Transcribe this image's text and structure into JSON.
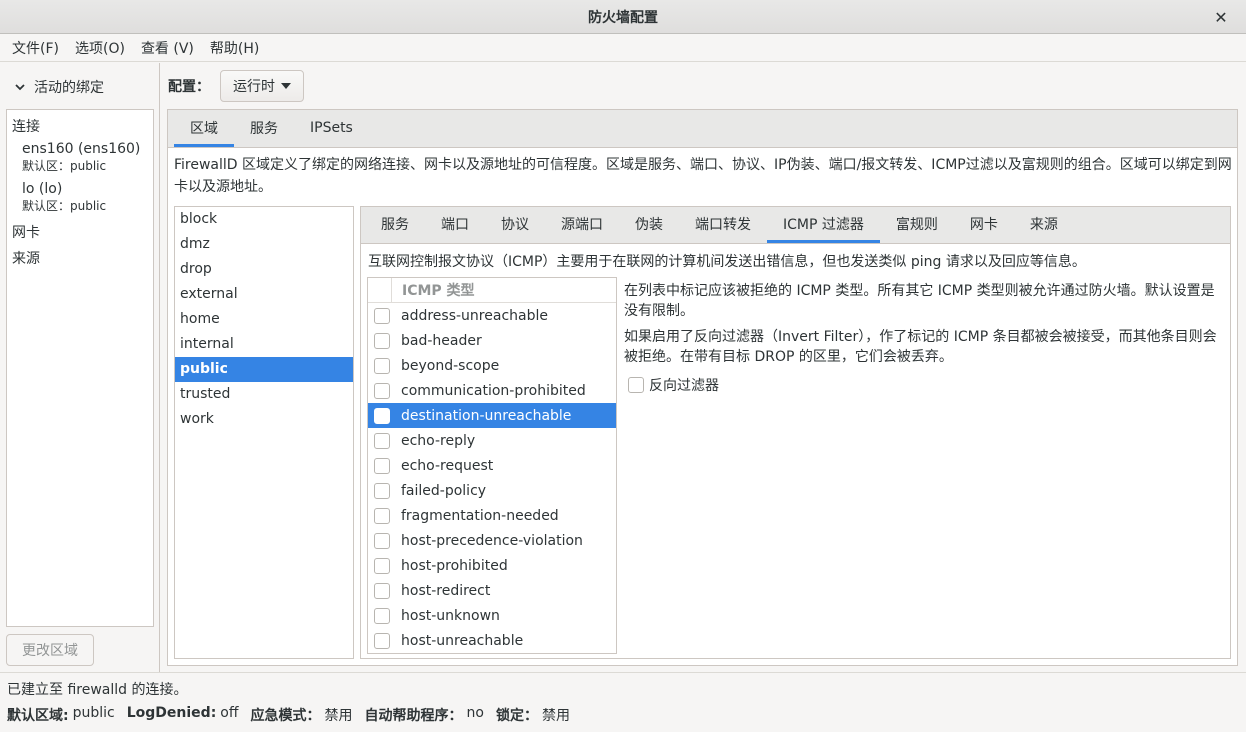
{
  "window": {
    "title": "防火墙配置"
  },
  "menu": [
    {
      "label": "文件(F)"
    },
    {
      "label": "选项(O)"
    },
    {
      "label": "查看 (V)"
    },
    {
      "label": "帮助(H)"
    }
  ],
  "bindings": {
    "header": "活动的绑定",
    "connections_heading": "连接",
    "connections": [
      {
        "name": "ens160 (ens160)",
        "zone": "默认区：public"
      },
      {
        "name": "lo (lo)",
        "zone": "默认区：public"
      }
    ],
    "interfaces_heading": "网卡",
    "sources_heading": "来源",
    "change_zone_button": "更改区域"
  },
  "config": {
    "label": "配置：",
    "value": "运行时"
  },
  "main_tabs": [
    {
      "label": "区域",
      "active": true
    },
    {
      "label": "服务",
      "active": false
    },
    {
      "label": "IPSets",
      "active": false
    }
  ],
  "zone_description": "FirewallD 区域定义了绑定的网络连接、网卡以及源地址的可信程度。区域是服务、端口、协议、IP伪装、端口/报文转发、ICMP过滤以及富规则的组合。区域可以绑定到网卡以及源地址。",
  "zones": [
    {
      "name": "block",
      "selected": false
    },
    {
      "name": "dmz",
      "selected": false
    },
    {
      "name": "drop",
      "selected": false
    },
    {
      "name": "external",
      "selected": false
    },
    {
      "name": "home",
      "selected": false
    },
    {
      "name": "internal",
      "selected": false
    },
    {
      "name": "public",
      "selected": true
    },
    {
      "name": "trusted",
      "selected": false
    },
    {
      "name": "work",
      "selected": false
    }
  ],
  "zone_tabs": [
    {
      "label": "服务",
      "active": false
    },
    {
      "label": "端口",
      "active": false
    },
    {
      "label": "协议",
      "active": false
    },
    {
      "label": "源端口",
      "active": false
    },
    {
      "label": "伪装",
      "active": false
    },
    {
      "label": "端口转发",
      "active": false
    },
    {
      "label": "ICMP 过滤器",
      "active": true
    },
    {
      "label": "富规则",
      "active": false
    },
    {
      "label": "网卡",
      "active": false
    },
    {
      "label": "来源",
      "active": false
    }
  ],
  "icmp": {
    "description": "互联网控制报文协议（ICMP）主要用于在联网的计算机间发送出错信息，但也发送类似 ping 请求以及回应等信息。",
    "column_header": "ICMP 类型",
    "types": [
      {
        "name": "address-unreachable",
        "checked": false,
        "selected": false
      },
      {
        "name": "bad-header",
        "checked": false,
        "selected": false
      },
      {
        "name": "beyond-scope",
        "checked": false,
        "selected": false
      },
      {
        "name": "communication-prohibited",
        "checked": false,
        "selected": false
      },
      {
        "name": "destination-unreachable",
        "checked": false,
        "selected": true
      },
      {
        "name": "echo-reply",
        "checked": false,
        "selected": false
      },
      {
        "name": "echo-request",
        "checked": false,
        "selected": false
      },
      {
        "name": "failed-policy",
        "checked": false,
        "selected": false
      },
      {
        "name": "fragmentation-needed",
        "checked": false,
        "selected": false
      },
      {
        "name": "host-precedence-violation",
        "checked": false,
        "selected": false
      },
      {
        "name": "host-prohibited",
        "checked": false,
        "selected": false
      },
      {
        "name": "host-redirect",
        "checked": false,
        "selected": false
      },
      {
        "name": "host-unknown",
        "checked": false,
        "selected": false
      },
      {
        "name": "host-unreachable",
        "checked": false,
        "selected": false
      }
    ],
    "help1": "在列表中标记应该被拒绝的 ICMP 类型。所有其它 ICMP 类型则被允许通过防火墙。默认设置是没有限制。",
    "help2": "如果启用了反向过滤器（Invert Filter），作了标记的 ICMP 条目都被会被接受，而其他条目则会被拒绝。在带有目标 DROP 的区里，它们会被丢弃。",
    "invert_label": "反向过滤器"
  },
  "status": {
    "line1": "已建立至 firewalld 的连接。",
    "default_zone_label": "默认区域:",
    "default_zone_value": "public",
    "logdenied_label": "LogDenied:",
    "logdenied_value": "off",
    "panic_label": "应急模式：",
    "panic_value": "禁用",
    "helper_label": "自动帮助程序：",
    "helper_value": "no",
    "lockdown_label": "锁定：",
    "lockdown_value": "禁用"
  }
}
